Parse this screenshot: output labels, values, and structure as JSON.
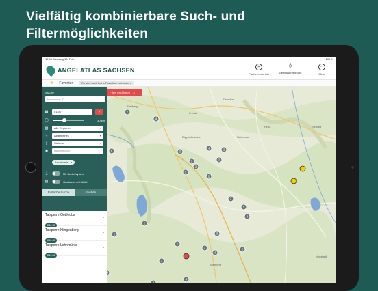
{
  "headline": {
    "line1": "Vielfältig kombinierbare Such- und",
    "line2": "Filtermöglichkeiten"
  },
  "statusbar": {
    "time": "12:05",
    "date": "Samstag 10. Feb.",
    "battery": "100 %"
  },
  "app": {
    "brand": "ANGELATLAS SACHSEN"
  },
  "nav": [
    {
      "label": "Fischverzeichnis",
      "icon": "fish-icon"
    },
    {
      "label": "Gewässerordnung",
      "icon": "rules-icon"
    },
    {
      "label": "Mehr",
      "icon": "more-icon"
    }
  ],
  "favorites": {
    "label": "Favoriten",
    "empty_text": "Es sind noch keine Favoriten vorhanden"
  },
  "sidebar": {
    "search_label": "Suche",
    "search_placeholder": "Name oder ID",
    "postal_code": "01187",
    "radius": "30 km",
    "radius_fraction": 0.35,
    "region": "Alle Regionen",
    "water_type": "Allgemeines",
    "water_kind": "Stehend",
    "fish_placeholder": "Hauptfischart",
    "chip": "Bachforelle",
    "toggle1": "Mit Schleifsystem",
    "toggle2": "Gastkarten erhältlich",
    "tab_simple": "Einfache Suche",
    "tab_search": "Suchen"
  },
  "results": [
    {
      "name": "Talsperre Gottleuba",
      "id": "D12-08"
    },
    {
      "name": "Talsperre Klingenberg",
      "id": "D12-05"
    },
    {
      "name": "Talsperre Lehnmühle",
      "id": "D12-05"
    }
  ],
  "map": {
    "filter_button": "Filter entfernen",
    "clusters": [
      "2",
      "4",
      "6",
      "3",
      "5",
      "2",
      "5",
      "4",
      "2",
      "2",
      "2",
      "3",
      "5",
      "4",
      "3",
      "2",
      "2",
      "4",
      "2",
      "2",
      "4",
      "3",
      "2",
      "2",
      "2"
    ],
    "labels": [
      "Freiberg",
      "Dippoldiswalde",
      "Dresden",
      "Pirna",
      "Heidenau",
      "Freital",
      "Altenberg",
      "Sebnitz",
      "Neustadt"
    ]
  }
}
